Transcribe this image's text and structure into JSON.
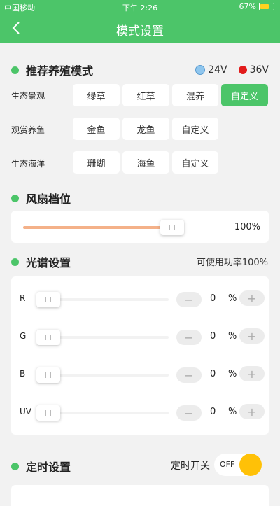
{
  "status": {
    "carrier": "中国移动",
    "time": "下午 2:26",
    "battery": "67%",
    "battery_level": 0.67
  },
  "nav": {
    "title": "模式设置",
    "back_icon": "chevron-left-icon"
  },
  "breeding": {
    "title": "推荐养殖模式",
    "volt_24": "24V",
    "volt_36": "36V",
    "colors": {
      "volt_24": "#8fc6ee",
      "volt_36": "#e21b1b"
    },
    "rows": [
      {
        "label": "生态景观",
        "options": [
          "绿草",
          "红草",
          "混养",
          "自定义"
        ],
        "selected": "自定义"
      },
      {
        "label": "观赏养鱼",
        "options": [
          "金鱼",
          "龙鱼",
          "自定义"
        ]
      },
      {
        "label": "生态海洋",
        "options": [
          "珊瑚",
          "海鱼",
          "自定义"
        ]
      }
    ]
  },
  "fan": {
    "title": "风扇档位",
    "value": "100%",
    "level": 1.0
  },
  "spectrum": {
    "title": "光谱设置",
    "power_note": "可使用功率100%",
    "channels": [
      {
        "label": "R",
        "value": "0",
        "unit": "%",
        "minus": "−",
        "plus": "+"
      },
      {
        "label": "G",
        "value": "0",
        "unit": "%",
        "minus": "−",
        "plus": "+"
      },
      {
        "label": "B",
        "value": "0",
        "unit": "%",
        "minus": "−",
        "plus": "+"
      },
      {
        "label": "UV",
        "value": "0",
        "unit": "%",
        "minus": "−",
        "plus": "+"
      }
    ]
  },
  "timer": {
    "title": "定时设置",
    "switch_label": "定时开关",
    "toggle_state": "OFF"
  },
  "colors": {
    "accent": "#4cc569",
    "fan_fill": "#f4b189",
    "toggle_knob": "#ffc107"
  }
}
